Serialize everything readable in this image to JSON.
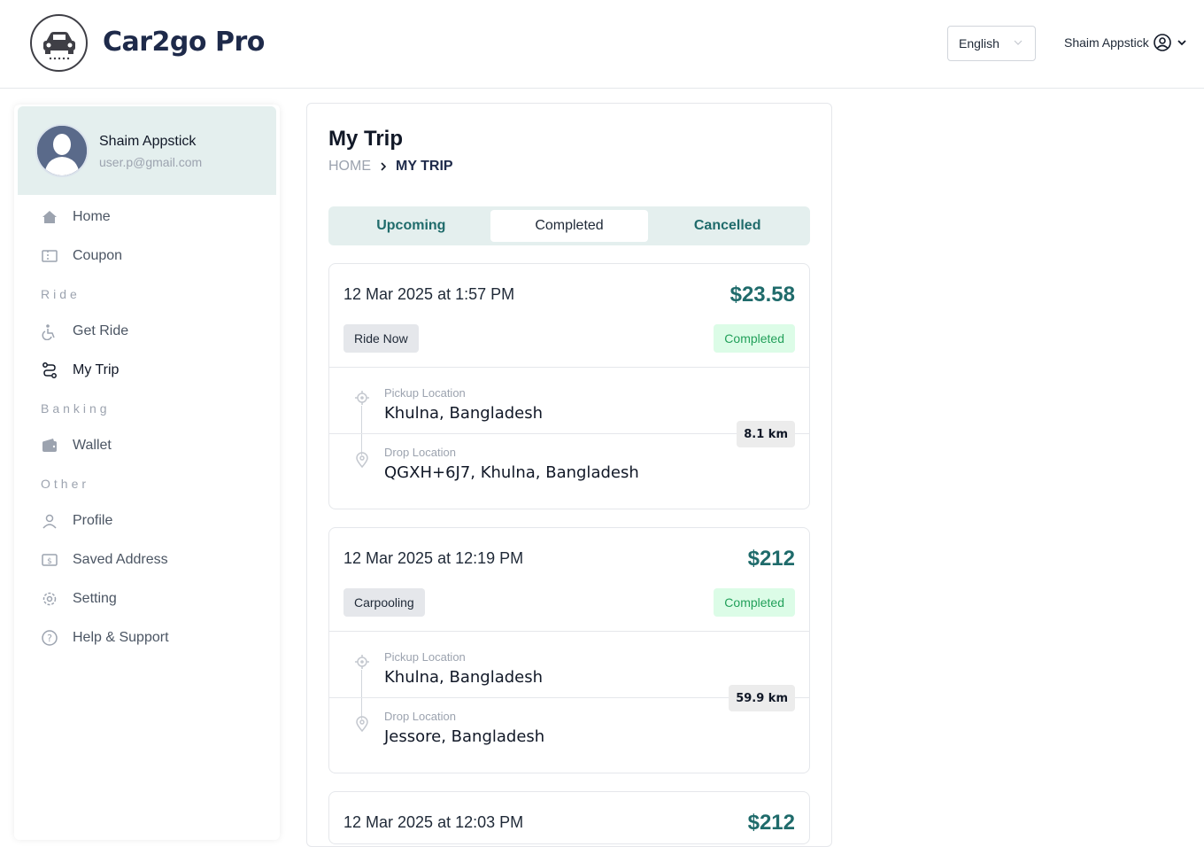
{
  "header": {
    "brand": "Car2go Pro",
    "language": "English",
    "user_name": "Shaim Appstick"
  },
  "sidebar": {
    "profile": {
      "name": "Shaim Appstick",
      "email": "user.p@gmail.com"
    },
    "items": [
      {
        "label": "Home",
        "icon": "home-icon"
      },
      {
        "label": "Coupon",
        "icon": "coupon-icon"
      },
      {
        "section": "Ride"
      },
      {
        "label": "Get Ride",
        "icon": "ride-icon"
      },
      {
        "label": "My Trip",
        "icon": "route-icon",
        "active": true
      },
      {
        "section": "Banking"
      },
      {
        "label": "Wallet",
        "icon": "wallet-icon"
      },
      {
        "section": "Other"
      },
      {
        "label": "Profile",
        "icon": "user-icon"
      },
      {
        "label": "Saved Address",
        "icon": "address-icon"
      },
      {
        "label": "Setting",
        "icon": "gear-icon"
      },
      {
        "label": "Help & Support",
        "icon": "help-icon"
      }
    ]
  },
  "main": {
    "title": "My Trip",
    "breadcrumb": {
      "home": "HOME",
      "current": "MY TRIP"
    },
    "tabs": [
      {
        "label": "Upcoming"
      },
      {
        "label": "Completed",
        "active": true
      },
      {
        "label": "Cancelled"
      }
    ],
    "trips": [
      {
        "date": "12 Mar 2025 at 1:57 PM",
        "price": "$23.58",
        "type": "Ride Now",
        "status": "Completed",
        "pickup_label": "Pickup Location",
        "pickup": "Khulna, Bangladesh",
        "drop_label": "Drop Location",
        "drop": "QGXH+6J7, Khulna, Bangladesh",
        "distance": "8.1 km"
      },
      {
        "date": "12 Mar 2025 at 12:19 PM",
        "price": "$212",
        "type": "Carpooling",
        "status": "Completed",
        "pickup_label": "Pickup Location",
        "pickup": "Khulna, Bangladesh",
        "drop_label": "Drop Location",
        "drop": "Jessore, Bangladesh",
        "distance": "59.9 km"
      },
      {
        "date": "12 Mar 2025 at 12:03 PM",
        "price": "$212"
      }
    ]
  },
  "colors": {
    "accent": "#1f6b6b",
    "brand_text": "#1e2a4a",
    "status_green": "#22a05a",
    "status_bg": "#dcfce7",
    "profile_bg": "#e4efee"
  }
}
